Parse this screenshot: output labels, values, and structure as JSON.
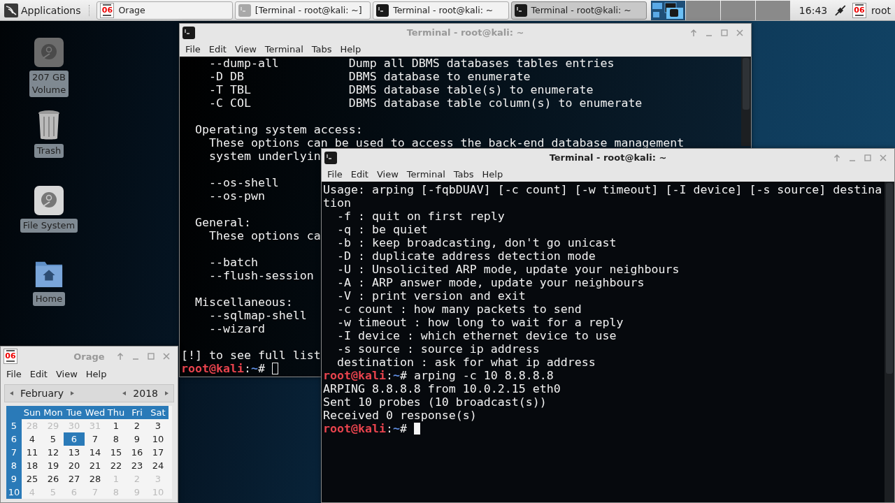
{
  "taskbar": {
    "menu_label": "Applications",
    "tasks": [
      {
        "label": "Orage",
        "icon": {
          "kind": "calendar",
          "day": "06"
        },
        "minimized": false,
        "selected": false
      },
      {
        "label": "[Terminal - root@kali: ~]",
        "icon": {
          "kind": "terminal"
        },
        "minimized": true,
        "selected": false
      },
      {
        "label": "Terminal - root@kali: ~",
        "icon": {
          "kind": "terminal"
        },
        "minimized": false,
        "selected": false
      },
      {
        "label": "Terminal - root@kali: ~",
        "icon": {
          "kind": "terminal"
        },
        "minimized": false,
        "selected": true
      }
    ],
    "workspaces": [
      {
        "selected": true
      },
      {
        "selected": false
      },
      {
        "selected": false
      },
      {
        "selected": false
      }
    ],
    "clock": "16:43",
    "tray_calendar": {
      "kind": "calendar",
      "day": "06"
    },
    "user": "root"
  },
  "desktop_icons": [
    {
      "kind": "drive",
      "lines": [
        "207 GB",
        "Volume"
      ]
    },
    {
      "kind": "trash",
      "lines": [
        "Trash"
      ]
    },
    {
      "kind": "disk",
      "lines": [
        "File System"
      ]
    },
    {
      "kind": "home",
      "lines": [
        "Home"
      ]
    }
  ],
  "terminals": [
    {
      "title": "Terminal - root@kali: ~",
      "focused": false,
      "menu": [
        "File",
        "Edit",
        "View",
        "Terminal",
        "Tabs",
        "Help"
      ],
      "lines": [
        {
          "kind": "text",
          "text": "    --dump-all          Dump all DBMS databases tables entries"
        },
        {
          "kind": "text",
          "text": "    -D DB               DBMS database to enumerate"
        },
        {
          "kind": "text",
          "text": "    -T TBL              DBMS database table(s) to enumerate"
        },
        {
          "kind": "text",
          "text": "    -C COL              DBMS database table column(s) to enumerate"
        },
        {
          "kind": "blank"
        },
        {
          "kind": "text",
          "text": "  Operating system access:"
        },
        {
          "kind": "text",
          "text": "    These options can be used to access the back-end database management"
        },
        {
          "kind": "text",
          "text": "    system underlyin"
        },
        {
          "kind": "blank"
        },
        {
          "kind": "text",
          "text": "    --os-shell"
        },
        {
          "kind": "text",
          "text": "    --os-pwn"
        },
        {
          "kind": "blank"
        },
        {
          "kind": "text",
          "text": "  General:"
        },
        {
          "kind": "text",
          "text": "    These options ca"
        },
        {
          "kind": "blank"
        },
        {
          "kind": "text",
          "text": "    --batch"
        },
        {
          "kind": "text",
          "text": "    --flush-session"
        },
        {
          "kind": "blank"
        },
        {
          "kind": "text",
          "text": "  Miscellaneous:"
        },
        {
          "kind": "text",
          "text": "    --sqlmap-shell"
        },
        {
          "kind": "text",
          "text": "    --wizard"
        },
        {
          "kind": "blank"
        },
        {
          "kind": "text",
          "text": "[!] to see full list"
        },
        {
          "kind": "prompt",
          "user": "root@kali",
          "sep": ":",
          "path": "~",
          "sign": "#",
          "cursor": true
        }
      ]
    },
    {
      "title": "Terminal - root@kali: ~",
      "focused": true,
      "menu": [
        "File",
        "Edit",
        "View",
        "Terminal",
        "Tabs",
        "Help"
      ],
      "lines": [
        {
          "kind": "text",
          "text": "Usage: arping [-fqbDUAV] [-c count] [-w timeout] [-I device] [-s source] destina"
        },
        {
          "kind": "text",
          "text": "tion"
        },
        {
          "kind": "text",
          "text": "  -f : quit on first reply"
        },
        {
          "kind": "text",
          "text": "  -q : be quiet"
        },
        {
          "kind": "text",
          "text": "  -b : keep broadcasting, don't go unicast"
        },
        {
          "kind": "text",
          "text": "  -D : duplicate address detection mode"
        },
        {
          "kind": "text",
          "text": "  -U : Unsolicited ARP mode, update your neighbours"
        },
        {
          "kind": "text",
          "text": "  -A : ARP answer mode, update your neighbours"
        },
        {
          "kind": "text",
          "text": "  -V : print version and exit"
        },
        {
          "kind": "text",
          "text": "  -c count : how many packets to send"
        },
        {
          "kind": "text",
          "text": "  -w timeout : how long to wait for a reply"
        },
        {
          "kind": "text",
          "text": "  -I device : which ethernet device to use"
        },
        {
          "kind": "text",
          "text": "  -s source : source ip address"
        },
        {
          "kind": "text",
          "text": "  destination : ask for what ip address"
        },
        {
          "kind": "prompt",
          "user": "root@kali",
          "sep": ":",
          "path": "~",
          "sign": "#",
          "command": "arping -c 10 8.8.8.8",
          "cursor": false
        },
        {
          "kind": "text",
          "text": "ARPING 8.8.8.8 from 10.0.2.15 eth0"
        },
        {
          "kind": "text",
          "text": "Sent 10 probes (10 broadcast(s))"
        },
        {
          "kind": "text",
          "text": "Received 0 response(s)"
        },
        {
          "kind": "prompt",
          "user": "root@kali",
          "sep": ":",
          "path": "~",
          "sign": "#",
          "cursor": true
        }
      ]
    }
  ],
  "calendar": {
    "title": "Orage",
    "focused": false,
    "icon": {
      "kind": "calendar",
      "day": "06"
    },
    "menu": [
      "File",
      "Edit",
      "View",
      "Help"
    ],
    "month": "February",
    "year": "2018",
    "weekdays": [
      "Sun",
      "Mon",
      "Tue",
      "Wed",
      "Thu",
      "Fri",
      "Sat"
    ],
    "weeks": [
      {
        "number": "5",
        "days": [
          {
            "label": "28",
            "in_month": false,
            "selected": false
          },
          {
            "label": "29",
            "in_month": false,
            "selected": false
          },
          {
            "label": "30",
            "in_month": false,
            "selected": false
          },
          {
            "label": "31",
            "in_month": false,
            "selected": false
          },
          {
            "label": "1",
            "in_month": true,
            "selected": false
          },
          {
            "label": "2",
            "in_month": true,
            "selected": false
          },
          {
            "label": "3",
            "in_month": true,
            "selected": false
          }
        ]
      },
      {
        "number": "6",
        "days": [
          {
            "label": "4",
            "in_month": true,
            "selected": false
          },
          {
            "label": "5",
            "in_month": true,
            "selected": false
          },
          {
            "label": "6",
            "in_month": true,
            "selected": true
          },
          {
            "label": "7",
            "in_month": true,
            "selected": false
          },
          {
            "label": "8",
            "in_month": true,
            "selected": false
          },
          {
            "label": "9",
            "in_month": true,
            "selected": false
          },
          {
            "label": "10",
            "in_month": true,
            "selected": false
          }
        ]
      },
      {
        "number": "7",
        "days": [
          {
            "label": "11",
            "in_month": true,
            "selected": false
          },
          {
            "label": "12",
            "in_month": true,
            "selected": false
          },
          {
            "label": "13",
            "in_month": true,
            "selected": false
          },
          {
            "label": "14",
            "in_month": true,
            "selected": false
          },
          {
            "label": "15",
            "in_month": true,
            "selected": false
          },
          {
            "label": "16",
            "in_month": true,
            "selected": false
          },
          {
            "label": "17",
            "in_month": true,
            "selected": false
          }
        ]
      },
      {
        "number": "8",
        "days": [
          {
            "label": "18",
            "in_month": true,
            "selected": false
          },
          {
            "label": "19",
            "in_month": true,
            "selected": false
          },
          {
            "label": "20",
            "in_month": true,
            "selected": false
          },
          {
            "label": "21",
            "in_month": true,
            "selected": false
          },
          {
            "label": "22",
            "in_month": true,
            "selected": false
          },
          {
            "label": "23",
            "in_month": true,
            "selected": false
          },
          {
            "label": "24",
            "in_month": true,
            "selected": false
          }
        ]
      },
      {
        "number": "9",
        "days": [
          {
            "label": "25",
            "in_month": true,
            "selected": false
          },
          {
            "label": "26",
            "in_month": true,
            "selected": false
          },
          {
            "label": "27",
            "in_month": true,
            "selected": false
          },
          {
            "label": "28",
            "in_month": true,
            "selected": false
          },
          {
            "label": "1",
            "in_month": false,
            "selected": false
          },
          {
            "label": "2",
            "in_month": false,
            "selected": false
          },
          {
            "label": "3",
            "in_month": false,
            "selected": false
          }
        ]
      },
      {
        "number": "10",
        "days": [
          {
            "label": "4",
            "in_month": false,
            "selected": false
          },
          {
            "label": "5",
            "in_month": false,
            "selected": false
          },
          {
            "label": "6",
            "in_month": false,
            "selected": false
          },
          {
            "label": "7",
            "in_month": false,
            "selected": false
          },
          {
            "label": "8",
            "in_month": false,
            "selected": false
          },
          {
            "label": "9",
            "in_month": false,
            "selected": false
          },
          {
            "label": "10",
            "in_month": false,
            "selected": false
          }
        ]
      }
    ]
  }
}
